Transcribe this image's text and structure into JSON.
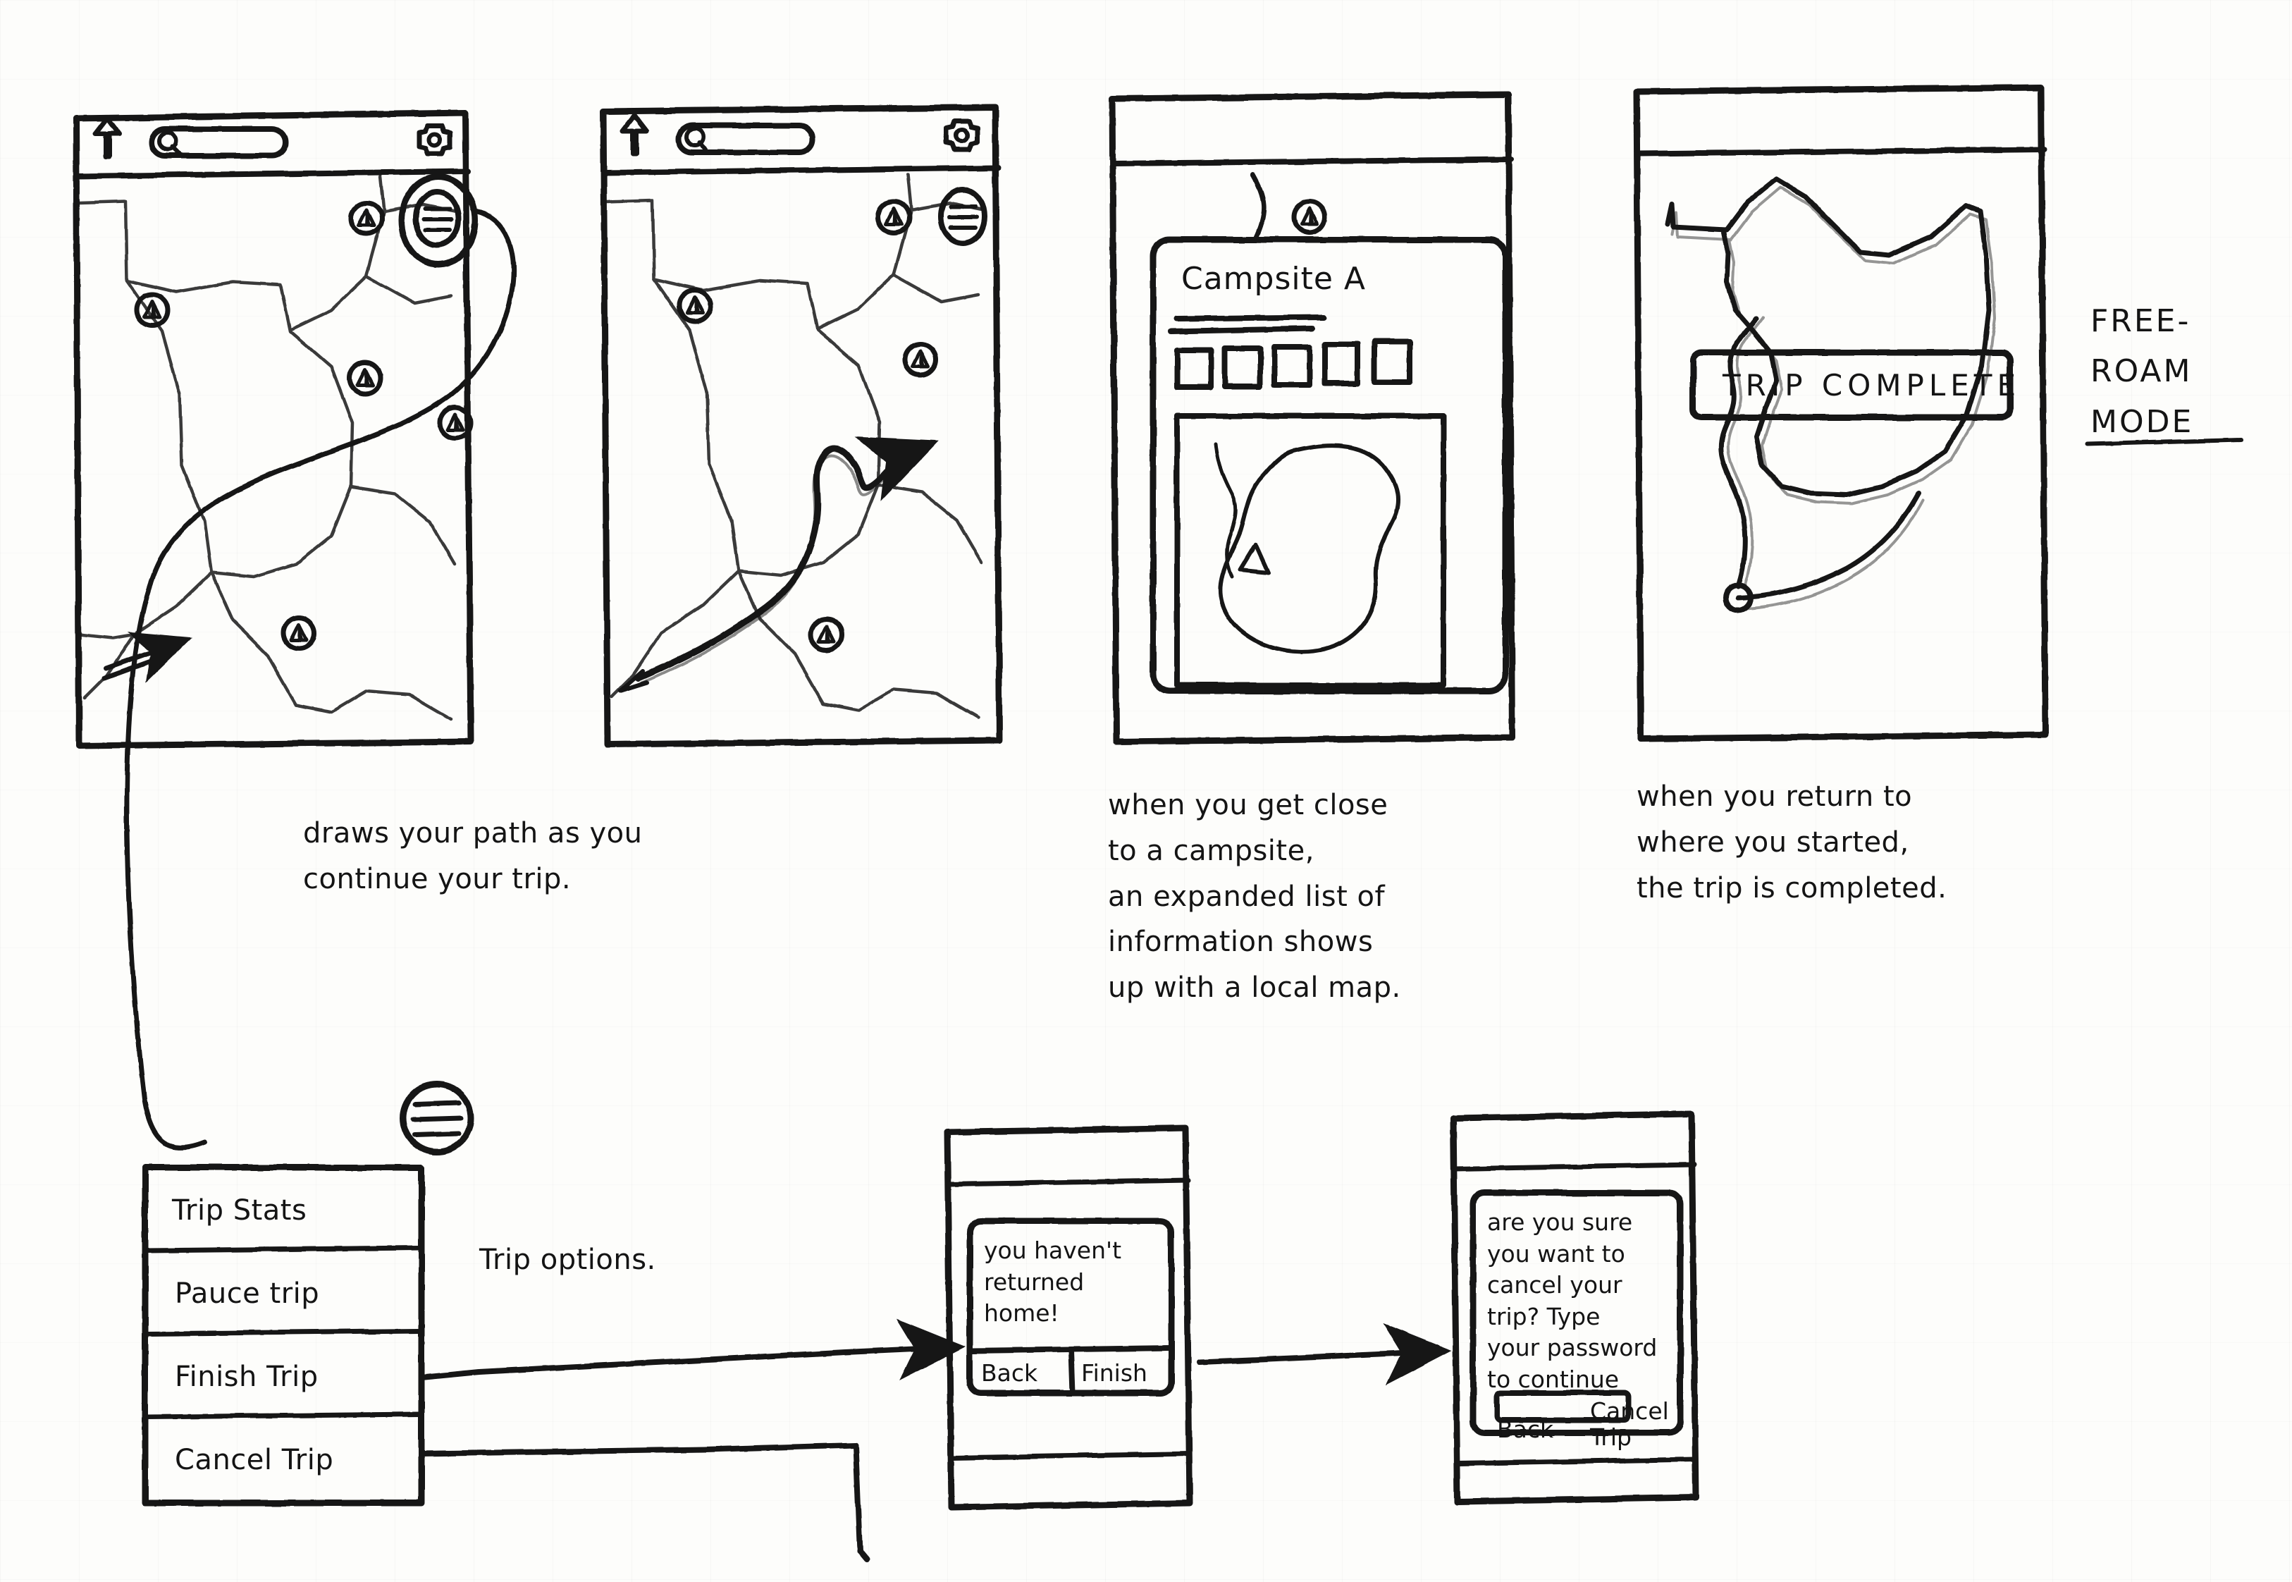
{
  "meta": {
    "kind": "hand-drawn-wireframe-sketch",
    "ink_color": "#141414",
    "paper_color": "#fdfdfb"
  },
  "annotations": {
    "free_roam_mode": "FREE-\nROAM\nMODE",
    "caption_path": "draws  your  path  as  you\ncontinue  your  trip.",
    "caption_campsite": "when  you  get  close\nto  a  campsite,\nan  expanded  list of\ninformation  shows\nup  with  a  local map.",
    "caption_complete": "when  you  return  to\nwhere  you  started,\nthe  trip  is  completed.",
    "trip_options_label": "Trip options."
  },
  "screens": [
    {
      "id": "screen-map-idle",
      "header": {
        "back_icon": "up-arrow-icon",
        "search_placeholder": "",
        "search_icon": "search-icon",
        "settings_icon": "gear-icon"
      },
      "menu_button": {
        "icon": "hamburger-menu-icon",
        "highlighted": true
      },
      "campsite_markers": 5,
      "marker_icon": "tent-marker-icon",
      "path_drawn": false,
      "start_arrow": true
    },
    {
      "id": "screen-map-tracking",
      "header": {
        "back_icon": "up-arrow-icon",
        "search_placeholder": "",
        "search_icon": "search-icon",
        "settings_icon": "gear-icon"
      },
      "menu_button": {
        "icon": "hamburger-menu-icon",
        "highlighted": false
      },
      "campsite_markers": 4,
      "marker_icon": "tent-marker-icon",
      "path_drawn": true,
      "path_arrow": true
    },
    {
      "id": "screen-campsite-detail",
      "header": {
        "back_icon": "up-arrow-icon"
      },
      "marker_icon": "tent-marker-icon",
      "card": {
        "title": "Campsite A",
        "detail_rules": 2,
        "thumbnails": 5,
        "local_map": {
          "shape": "lake-outline",
          "tent_icon": "tent-triangle-icon"
        }
      }
    },
    {
      "id": "screen-trip-complete",
      "banner": "TRIP  COMPLETE",
      "path_drawn": true,
      "end_marker": "trip-end-dot"
    }
  ],
  "trip_options_menu": {
    "items": [
      {
        "label": "Trip Stats"
      },
      {
        "label": "Pauce trip"
      },
      {
        "label": "Finish Trip"
      },
      {
        "label": "Cancel Trip"
      }
    ],
    "icon": "hamburger-menu-icon"
  },
  "dialog_finish": {
    "message": "you haven't\nreturned\nhome!",
    "buttons": [
      {
        "label": "Back"
      },
      {
        "label": "Finish"
      }
    ]
  },
  "dialog_cancel": {
    "message": "are you sure\nyou want to\ncancel your\ntrip? Type\nyour password\nto continue",
    "password_field_value": "",
    "buttons": [
      {
        "label": "Back"
      },
      {
        "label": "Cancel\nTrip"
      }
    ]
  }
}
